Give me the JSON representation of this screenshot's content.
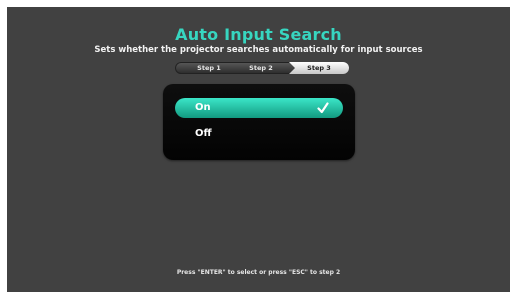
{
  "header": {
    "title": "Auto Input Search",
    "subtitle": "Sets whether the projector searches automatically for input sources"
  },
  "steps": {
    "items": [
      "Step 1",
      "Step 2",
      "Step 3"
    ],
    "active_index": 2
  },
  "options": {
    "items": [
      {
        "label": "On",
        "selected": true,
        "icon": "checkmark-icon"
      },
      {
        "label": "Off",
        "selected": false
      }
    ]
  },
  "footer": {
    "hint": "Press \"ENTER\" to select or press \"ESC\" to step 2"
  },
  "colors": {
    "background": "#414141",
    "accent": "#37d6c0",
    "selected_option": "#1fbf9f",
    "panel": "#080808",
    "text": "#ffffff"
  }
}
